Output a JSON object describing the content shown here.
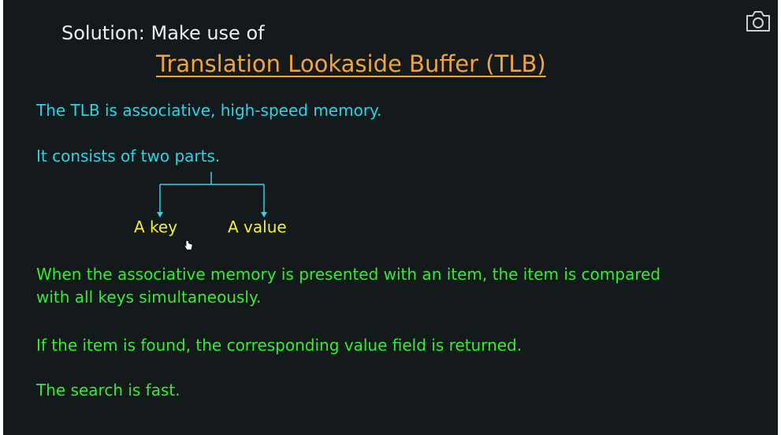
{
  "slide": {
    "heading": "Solution: Make use of",
    "title": "Translation Lookaside Buffer (TLB)",
    "line1": "The TLB is associative, high-speed memory.",
    "line2": "It consists of two parts.",
    "part_key": "A key",
    "part_value": "A value",
    "para1": "When the associative memory is presented with an item, the item is compared with all keys simultaneously.",
    "para2": "If the item is found, the corresponding value field is returned.",
    "para3": "The search is fast."
  },
  "icons": {
    "camera": "camera-icon",
    "cursor": "hand-pointer-cursor-icon"
  },
  "colors": {
    "background": "#141a1b",
    "heading": "#eeeeee",
    "title": "#f2a33a",
    "cyan": "#2fd4e4",
    "yellow": "#f3ef36",
    "green": "#33ee33"
  }
}
